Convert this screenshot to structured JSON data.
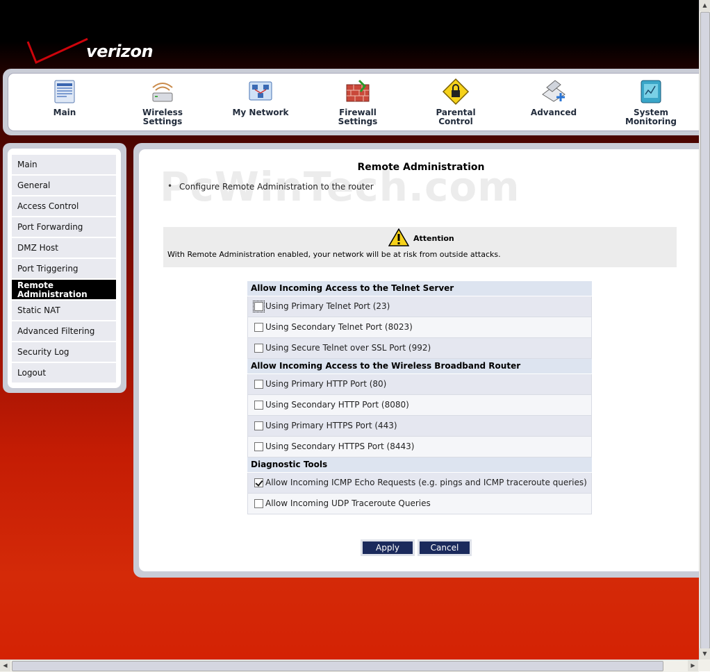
{
  "brand": {
    "name": "verizon"
  },
  "topnav": [
    {
      "id": "main",
      "label": "Main",
      "icon": "main-icon"
    },
    {
      "id": "wireless",
      "label": "Wireless Settings",
      "icon": "wireless-settings-icon"
    },
    {
      "id": "mynetwork",
      "label": "My Network",
      "icon": "my-network-icon"
    },
    {
      "id": "firewall",
      "label": "Firewall Settings",
      "icon": "firewall-settings-icon"
    },
    {
      "id": "parental",
      "label": "Parental Control",
      "icon": "parental-control-icon"
    },
    {
      "id": "advanced",
      "label": "Advanced",
      "icon": "advanced-icon"
    },
    {
      "id": "sysmon",
      "label": "System Monitoring",
      "icon": "system-monitoring-icon"
    }
  ],
  "sidebar": {
    "items": [
      {
        "label": "Main"
      },
      {
        "label": "General"
      },
      {
        "label": "Access Control"
      },
      {
        "label": "Port Forwarding"
      },
      {
        "label": "DMZ Host"
      },
      {
        "label": "Port Triggering"
      },
      {
        "label": "Remote Administration",
        "active": true
      },
      {
        "label": "Static NAT"
      },
      {
        "label": "Advanced Filtering"
      },
      {
        "label": "Security Log"
      },
      {
        "label": "Logout"
      }
    ]
  },
  "main": {
    "watermark": "PcWinTech.com",
    "title": "Remote Administration",
    "intro": "Configure Remote Administration to the router",
    "attention": {
      "title": "Attention",
      "message": "With Remote Administration enabled, your network will be at risk from outside attacks."
    },
    "sections": [
      {
        "title": "Allow Incoming Access to the Telnet Server",
        "rows": [
          {
            "label": "Using Primary Telnet Port (23)",
            "checked": false
          },
          {
            "label": "Using Secondary Telnet Port (8023)",
            "checked": false
          },
          {
            "label": "Using Secure Telnet over SSL Port (992)",
            "checked": false
          }
        ]
      },
      {
        "title": "Allow Incoming Access to the Wireless Broadband Router",
        "rows": [
          {
            "label": "Using Primary HTTP Port (80)",
            "checked": false
          },
          {
            "label": "Using Secondary HTTP Port (8080)",
            "checked": false
          },
          {
            "label": "Using Primary HTTPS Port (443)",
            "checked": false
          },
          {
            "label": "Using Secondary HTTPS Port (8443)",
            "checked": false
          }
        ]
      },
      {
        "title": "Diagnostic Tools",
        "rows": [
          {
            "label": "Allow Incoming ICMP Echo Requests (e.g. pings and ICMP traceroute queries)",
            "checked": true
          },
          {
            "label": "Allow Incoming UDP Traceroute Queries",
            "checked": false
          }
        ]
      }
    ],
    "buttons": {
      "apply": "Apply",
      "cancel": "Cancel"
    }
  },
  "colors": {
    "accent_navy": "#1b2a5c",
    "brand_red": "#cd040b"
  }
}
